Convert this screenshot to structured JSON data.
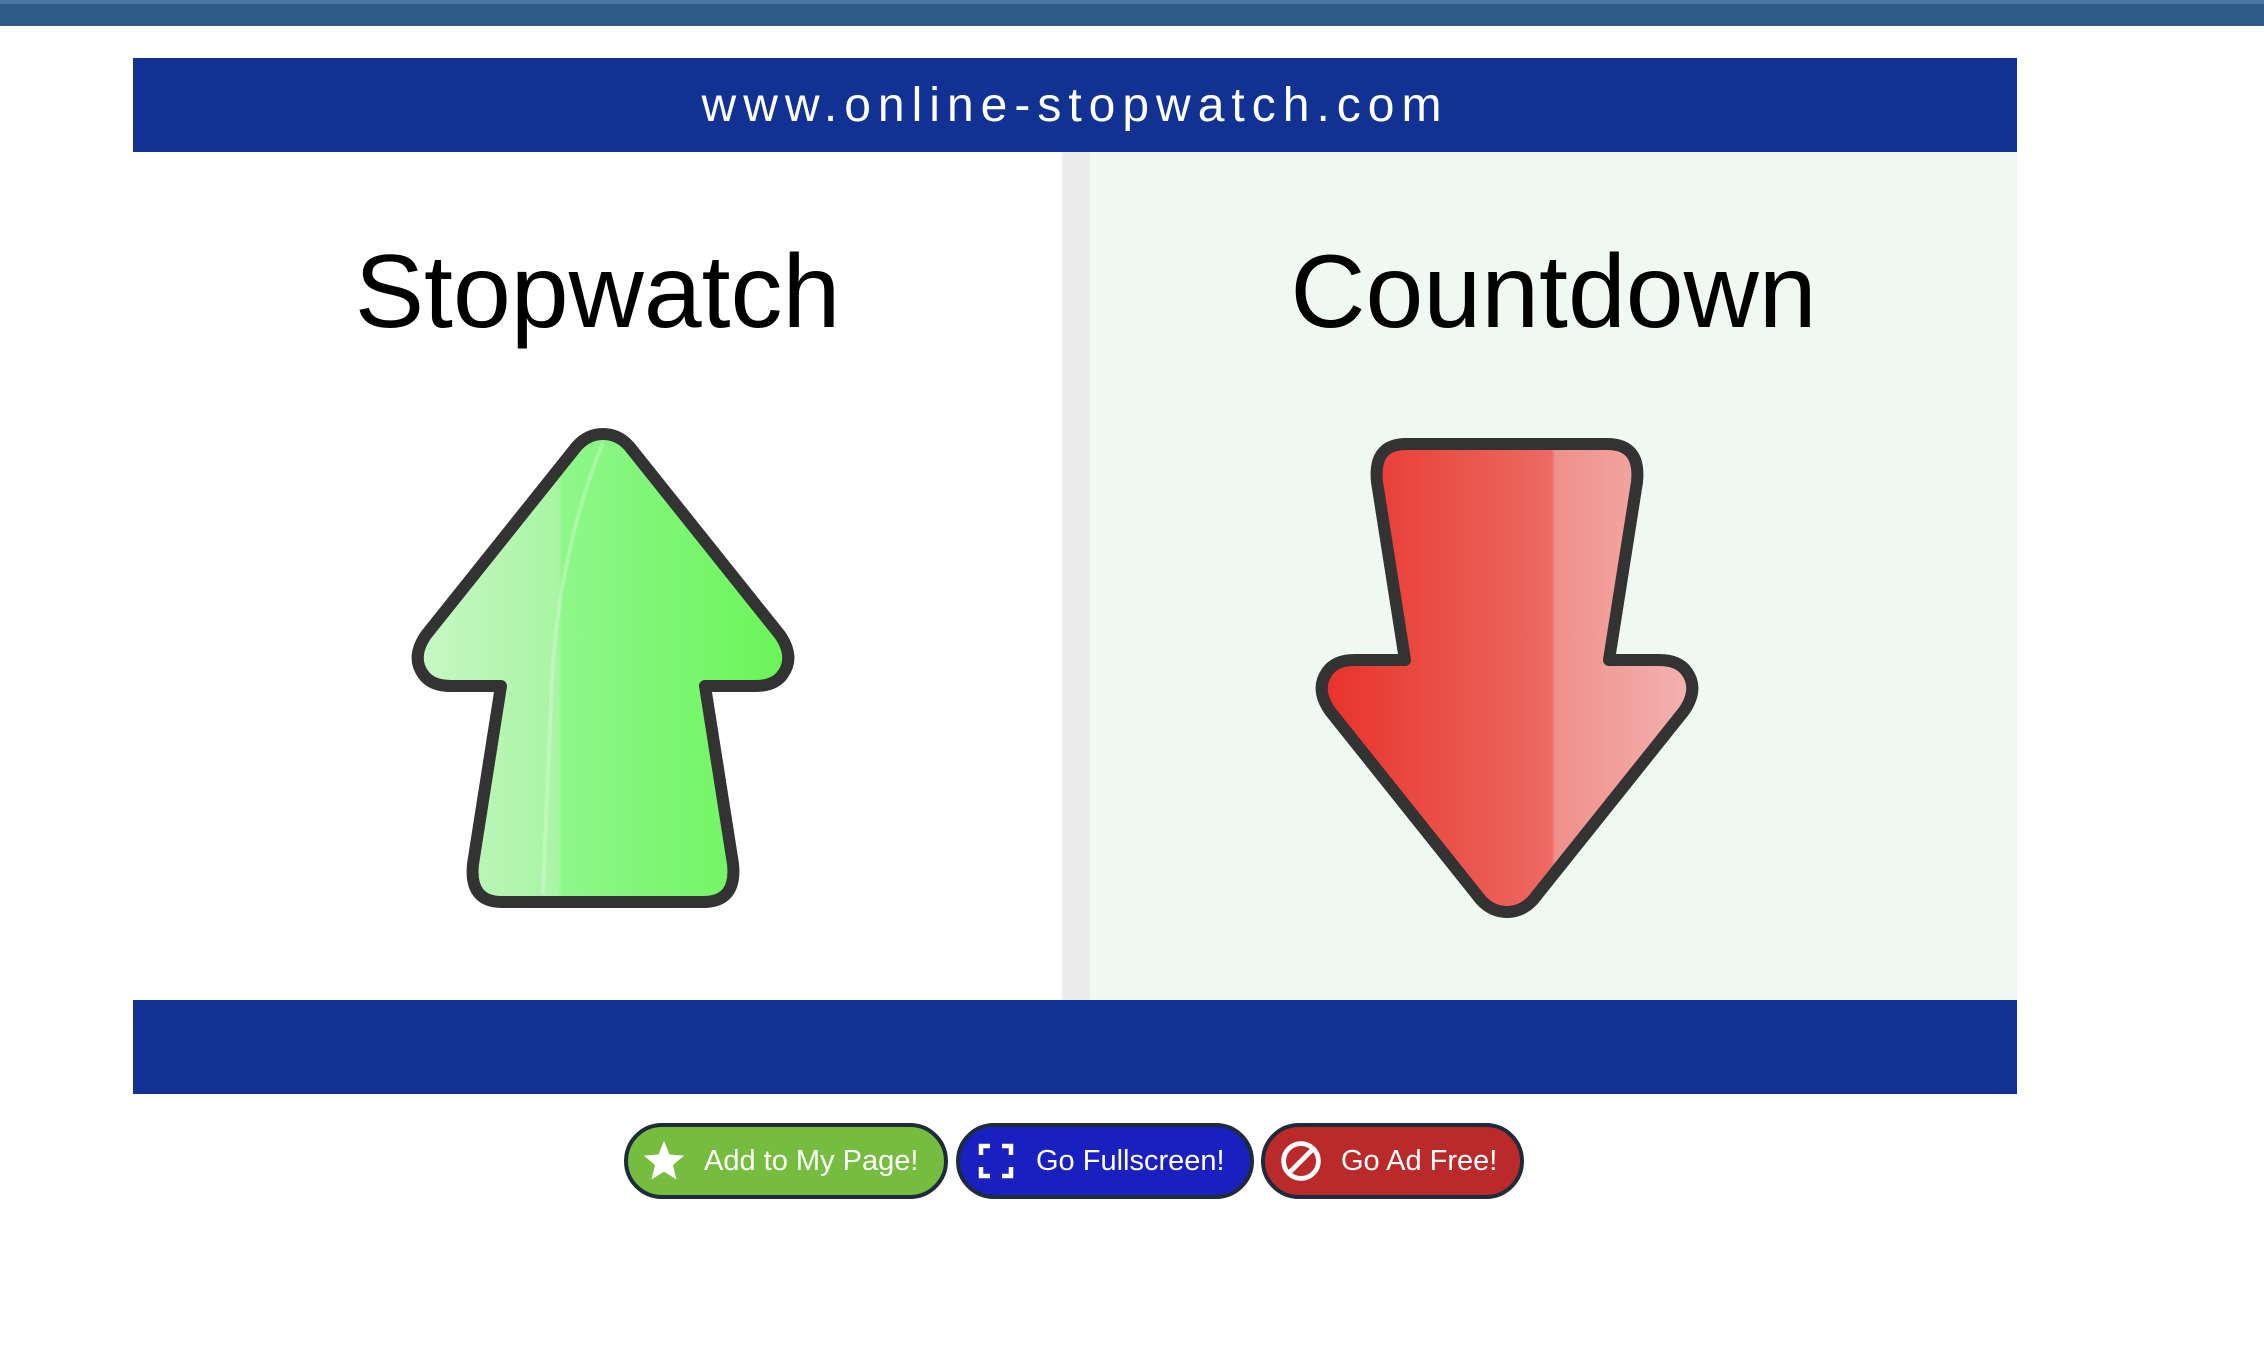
{
  "header": {
    "url_text": "www.online-stopwatch.com"
  },
  "panels": {
    "stopwatch": {
      "title": "Stopwatch",
      "icon": "up-arrow-icon",
      "color": "#6cf55a"
    },
    "countdown": {
      "title": "Countdown",
      "icon": "down-arrow-icon",
      "color": "#e8352b"
    }
  },
  "buttons": {
    "add": {
      "label": "Add to My Page!",
      "icon": "star-icon",
      "color": "#76bd3f"
    },
    "fullscreen": {
      "label": "Go Fullscreen!",
      "icon": "fullscreen-icon",
      "color": "#1a20c0"
    },
    "adfree": {
      "label": "Go Ad Free!",
      "icon": "no-sign-icon",
      "color": "#bb2a2a"
    }
  },
  "colors": {
    "band": "#123293",
    "top_bar": "#2e5a87",
    "countdown_bg": "#eff9f1"
  }
}
